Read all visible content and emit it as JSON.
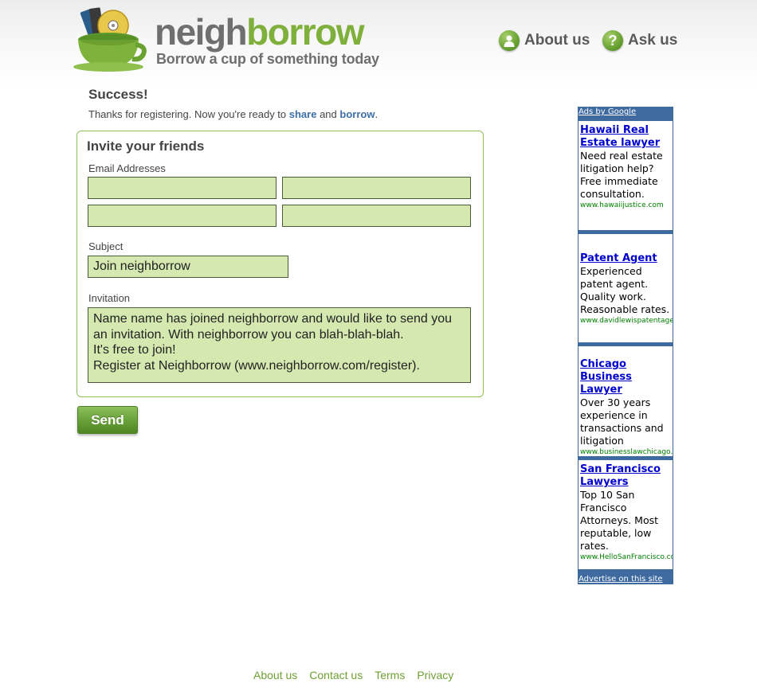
{
  "brand": {
    "name_part1": "neigh",
    "name_part2": "borrow",
    "tagline": "Borrow a cup of something today"
  },
  "nav": {
    "about": "About us",
    "ask": "Ask us"
  },
  "success": {
    "title": "Success!",
    "text_before": "Thanks for registering. Now you're ready to ",
    "share_link": "share",
    "and": " and ",
    "borrow_link": "borrow",
    "period": "."
  },
  "invite": {
    "title": "Invite your friends",
    "email_label": "Email Addresses",
    "emails": [
      "",
      "",
      "",
      ""
    ],
    "subject_label": "Subject",
    "subject_value": "Join neighborrow",
    "invitation_label": "Invitation",
    "invitation_value": "Name name has joined neighborrow and would like to send you an invitation. With neighborrow you can blah-blah-blah.\nIt's free to join!\nRegister at Neighborrow (www.neighborrow.com/register).",
    "send_label": "Send"
  },
  "ads": {
    "header": "Ads by Google",
    "footer": "Advertise on this site",
    "items": [
      {
        "title": "Hawaii Real Estate lawyer",
        "desc": "Need real estate litigation help? Free immediate consultation.",
        "url": "www.hawaiijustice.com"
      },
      {
        "title": "Patent Agent",
        "desc": "Experienced patent agent. Quality work. Reasonable rates.",
        "url": "www.davidlewispatentagent.com"
      },
      {
        "title": "Chicago Business Lawyer",
        "desc": "Over 30 years experience in transactions and litigation",
        "url": "www.businesslawchicago.com"
      },
      {
        "title": "San Francisco Lawyers",
        "desc": "Top 10 San Francisco Attorneys. Most reputable, low rates.",
        "url": "www.HelloSanFrancisco.com"
      }
    ]
  },
  "footer": {
    "links": [
      "About us",
      "Contact us",
      "Terms",
      "Privacy"
    ]
  },
  "colors": {
    "brand_green": "#7fb03c",
    "brand_gray": "#6f6f6f",
    "field_fill": "#d4e8b0",
    "link_blue": "#3c6fa9",
    "ads_blue": "#3e6aa0"
  }
}
